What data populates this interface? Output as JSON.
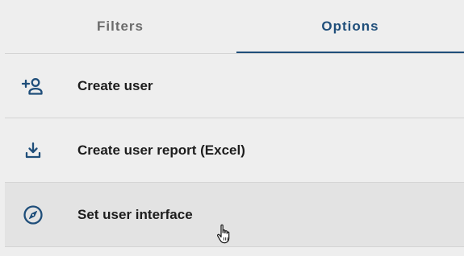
{
  "tabs": [
    {
      "label": "Filters",
      "active": false
    },
    {
      "label": "Options",
      "active": true
    }
  ],
  "menu": {
    "items": [
      {
        "label": "Create user",
        "icon": "add-person-icon"
      },
      {
        "label": "Create user report (Excel)",
        "icon": "download-icon"
      },
      {
        "label": "Set user interface",
        "icon": "compass-icon",
        "hovered": true
      }
    ]
  },
  "colors": {
    "accent": "#1f4e7a",
    "inactive_tab": "#6b6b6b",
    "background": "#eeeeee",
    "hover_background": "#e3e3e3",
    "divider": "#d4d4d4"
  }
}
